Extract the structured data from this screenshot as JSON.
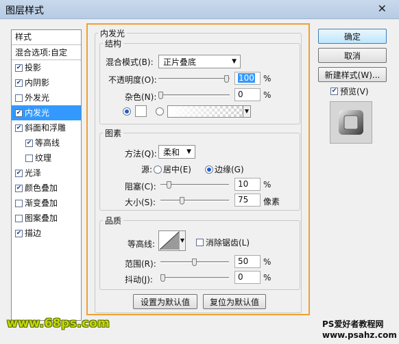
{
  "window": {
    "title": "图层样式",
    "close_glyph": "✕"
  },
  "styles_panel": {
    "header": "样式",
    "blend_options": "混合选项:自定",
    "items": [
      {
        "label": "投影",
        "checked": true,
        "sub": false,
        "active": false
      },
      {
        "label": "内阴影",
        "checked": true,
        "sub": false,
        "active": false
      },
      {
        "label": "外发光",
        "checked": false,
        "sub": false,
        "active": false
      },
      {
        "label": "内发光",
        "checked": true,
        "sub": false,
        "active": true
      },
      {
        "label": "斜面和浮雕",
        "checked": true,
        "sub": false,
        "active": false
      },
      {
        "label": "等高线",
        "checked": true,
        "sub": true,
        "active": false
      },
      {
        "label": "纹理",
        "checked": false,
        "sub": true,
        "active": false
      },
      {
        "label": "光泽",
        "checked": true,
        "sub": false,
        "active": false
      },
      {
        "label": "颜色叠加",
        "checked": true,
        "sub": false,
        "active": false
      },
      {
        "label": "渐变叠加",
        "checked": false,
        "sub": false,
        "active": false
      },
      {
        "label": "图案叠加",
        "checked": false,
        "sub": false,
        "active": false
      },
      {
        "label": "描边",
        "checked": true,
        "sub": false,
        "active": false
      }
    ]
  },
  "inner_glow": {
    "title": "内发光",
    "structure": {
      "title": "结构",
      "blend_mode_label": "混合模式(B):",
      "blend_mode_value": "正片叠底",
      "opacity_label": "不透明度(O):",
      "opacity_value": "100",
      "opacity_unit": "%",
      "noise_label": "杂色(N):",
      "noise_value": "0",
      "noise_unit": "%",
      "opacity_level": 1.0,
      "noise_level": 0.0
    },
    "elements": {
      "title": "图素",
      "method_label": "方法(Q):",
      "method_value": "柔和",
      "source_label": "源:",
      "source_center": "居中(E)",
      "source_edge": "边缘(G)",
      "choke_label": "阻塞(C):",
      "choke_value": "10",
      "choke_unit": "%",
      "size_label": "大小(S):",
      "size_value": "75",
      "size_unit": "像素",
      "choke_level": 0.1,
      "size_level": 0.3
    },
    "quality": {
      "title": "品质",
      "contour_label": "等高线:",
      "anti_alias_label": "消除锯齿(L)",
      "range_label": "范围(R):",
      "range_value": "50",
      "range_unit": "%",
      "jitter_label": "抖动(J):",
      "jitter_value": "0",
      "jitter_unit": "%",
      "range_level": 0.5,
      "jitter_level": 0.0
    },
    "make_default": "设置为默认值",
    "reset_default": "复位为默认值"
  },
  "actions": {
    "ok": "确定",
    "cancel": "取消",
    "new_style": "新建样式(W)...",
    "preview_label": "预览(V)",
    "preview_checked": true
  },
  "watermarks": {
    "left": "www.68ps.com",
    "right_line1": "PS爱好者教程网",
    "right_line2": "www.psahz.com"
  }
}
